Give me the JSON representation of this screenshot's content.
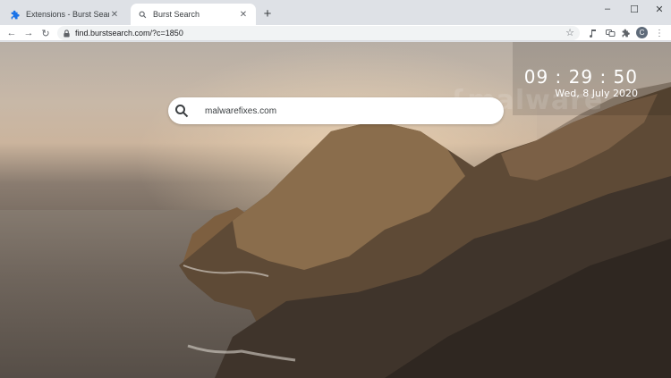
{
  "tabs": [
    {
      "title": "Extensions - Burst Search",
      "icon": "puzzle-icon",
      "active": false
    },
    {
      "title": "Burst Search",
      "icon": "search-icon",
      "active": true
    }
  ],
  "window_controls": {
    "minimize": "–",
    "maximize": "☐",
    "close": "✕"
  },
  "toolbar": {
    "url": "find.burstsearch.com/?c=1850",
    "back": "←",
    "forward": "→",
    "reload": "↻",
    "star": "☆",
    "profile_initial": "C",
    "menu": "⋮"
  },
  "page": {
    "search_value": "malwarefixes.com",
    "clock_time": "09 : 29 : 50",
    "clock_date": "Wed, 8 July 2020",
    "watermark": "{malware"
  }
}
